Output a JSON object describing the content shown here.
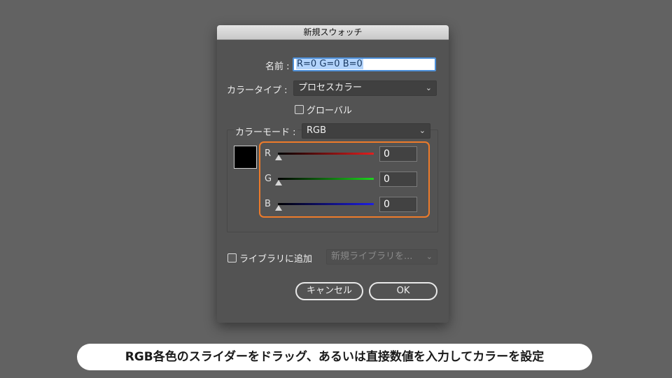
{
  "dialog": {
    "title": "新規スウォッチ",
    "name_label": "名前 :",
    "name_value": "R=0 G=0 B=0",
    "color_type_label": "カラータイプ :",
    "color_type_value": "プロセスカラー",
    "global_label": "グローバル",
    "color_mode_label": "カラーモード :",
    "color_mode_value": "RGB",
    "swatch_color": "#000000",
    "channels": [
      {
        "label": "R",
        "value": "0",
        "color": "#e41e1e"
      },
      {
        "label": "G",
        "value": "0",
        "color": "#1ed41e"
      },
      {
        "label": "B",
        "value": "0",
        "color": "#1e1ee4"
      }
    ],
    "add_to_library_label": "ライブラリに追加",
    "library_placeholder": "新規ライブラリを...",
    "cancel_label": "キャンセル",
    "ok_label": "OK"
  },
  "caption": "RGB各色のスライダーをドラッグ、あるいは直接数値を入力してカラーを設定",
  "colors": {
    "highlight": "#ee7b2a",
    "background": "#626262",
    "dialog": "#535353"
  },
  "icons": [
    "chevron-down-icon",
    "checkbox-icon",
    "slider-thumb-icon"
  ]
}
